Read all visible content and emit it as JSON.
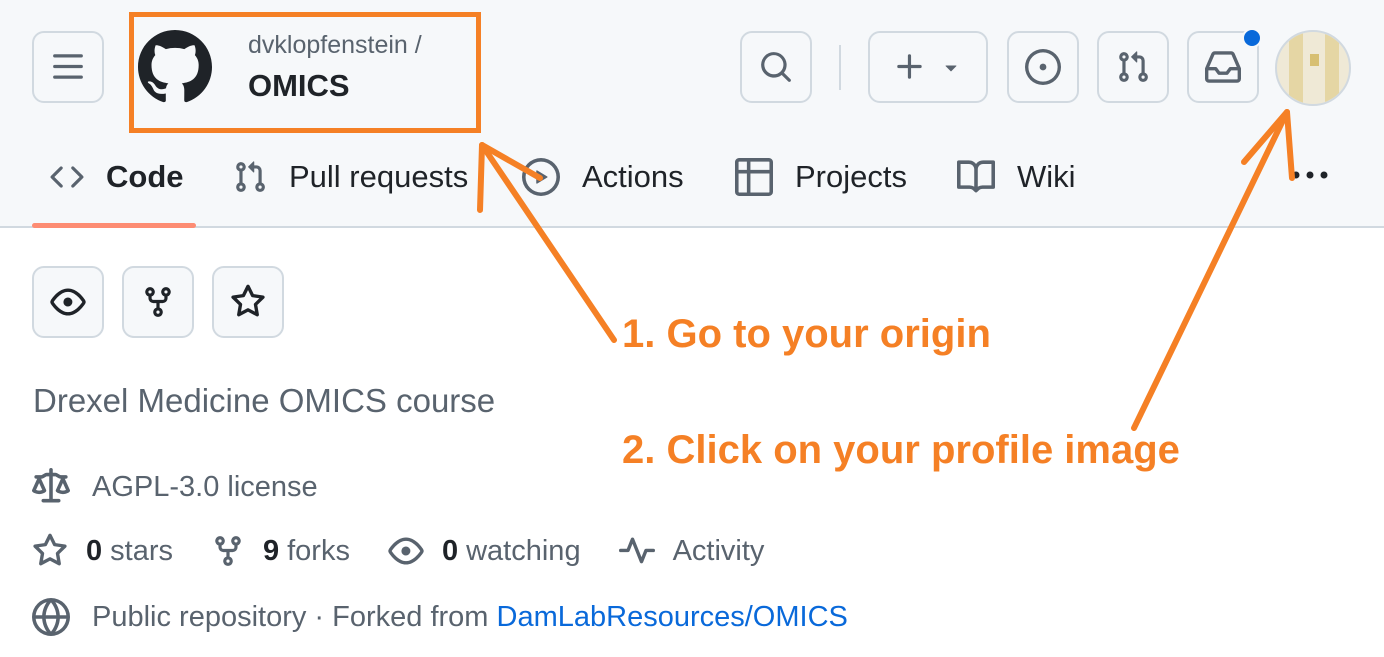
{
  "repo": {
    "owner": "dvklopfenstein /",
    "name": "OMICS",
    "description": "Drexel Medicine OMICS course",
    "license": "AGPL-3.0 license"
  },
  "tabs": [
    {
      "label": "Code",
      "icon": "code-icon",
      "selected": true
    },
    {
      "label": "Pull requests",
      "icon": "git-pull-request-icon"
    },
    {
      "label": "Actions",
      "icon": "play-icon"
    },
    {
      "label": "Projects",
      "icon": "table-icon"
    },
    {
      "label": "Wiki",
      "icon": "book-icon"
    }
  ],
  "stats": {
    "stars_count": "0",
    "stars_label": "stars",
    "forks_count": "9",
    "forks_label": "forks",
    "watching_count": "0",
    "watching_label": "watching",
    "activity_label": "Activity"
  },
  "public": {
    "text": "Public repository · Forked from ",
    "fork_source": "DamLabResources/OMICS"
  },
  "annotations": {
    "step1": "1. Go to your origin",
    "step2": "2. Click on your profile image"
  },
  "colors": {
    "annotation": "#f58025",
    "link": "#0969da",
    "tab_underline": "#fd8c73",
    "notification": "#0969da"
  }
}
